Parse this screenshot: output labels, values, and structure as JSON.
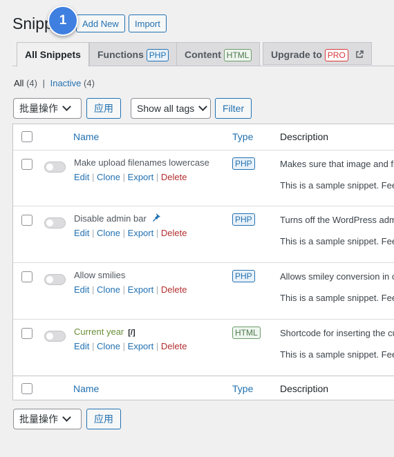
{
  "header": {
    "title": "Snipp",
    "add_new_label": "Add New",
    "import_label": "Import",
    "step_badge": "1"
  },
  "tabs": [
    {
      "label": "All Snippets",
      "active": true
    },
    {
      "label": "Functions",
      "tag": "PHP"
    },
    {
      "label": "Content",
      "tag": "HTML"
    },
    {
      "label": "Upgrade to",
      "tag": "PRO"
    }
  ],
  "filters": {
    "all_label": "All",
    "all_count": "(4)",
    "separator": "|",
    "inactive_label": "Inactive",
    "inactive_count": "(4)"
  },
  "bulk": {
    "action_label": "批量操作",
    "apply_label": "应用"
  },
  "tag_filter": {
    "select_label": "Show all tags",
    "filter_label": "Filter"
  },
  "table": {
    "columns": {
      "name": "Name",
      "type": "Type",
      "description": "Description"
    },
    "rows": [
      {
        "name": "Make upload filenames lowercase",
        "type": "PHP",
        "desc1": "Makes sure that image and fi",
        "desc2": "This is a sample snippet. Feel",
        "icon": null
      },
      {
        "name": "Disable admin bar",
        "type": "PHP",
        "desc1": "Turns off the WordPress adm",
        "desc2": "This is a sample snippet. Feel",
        "icon": "pin-icon"
      },
      {
        "name": "Allow smilies",
        "type": "PHP",
        "desc1": "Allows smiley conversion in o",
        "desc2": "This is a sample snippet. Feel",
        "icon": null
      },
      {
        "name": "Current year",
        "type": "HTML",
        "desc1": "Shortcode for inserting the cu",
        "desc2": "This is a sample snippet. Feel",
        "icon": "shortcode-icon",
        "icon_text": "[/]"
      }
    ],
    "row_actions": {
      "edit": "Edit",
      "clone": "Clone",
      "export": "Export",
      "delete": "Delete",
      "sep": "|"
    }
  }
}
